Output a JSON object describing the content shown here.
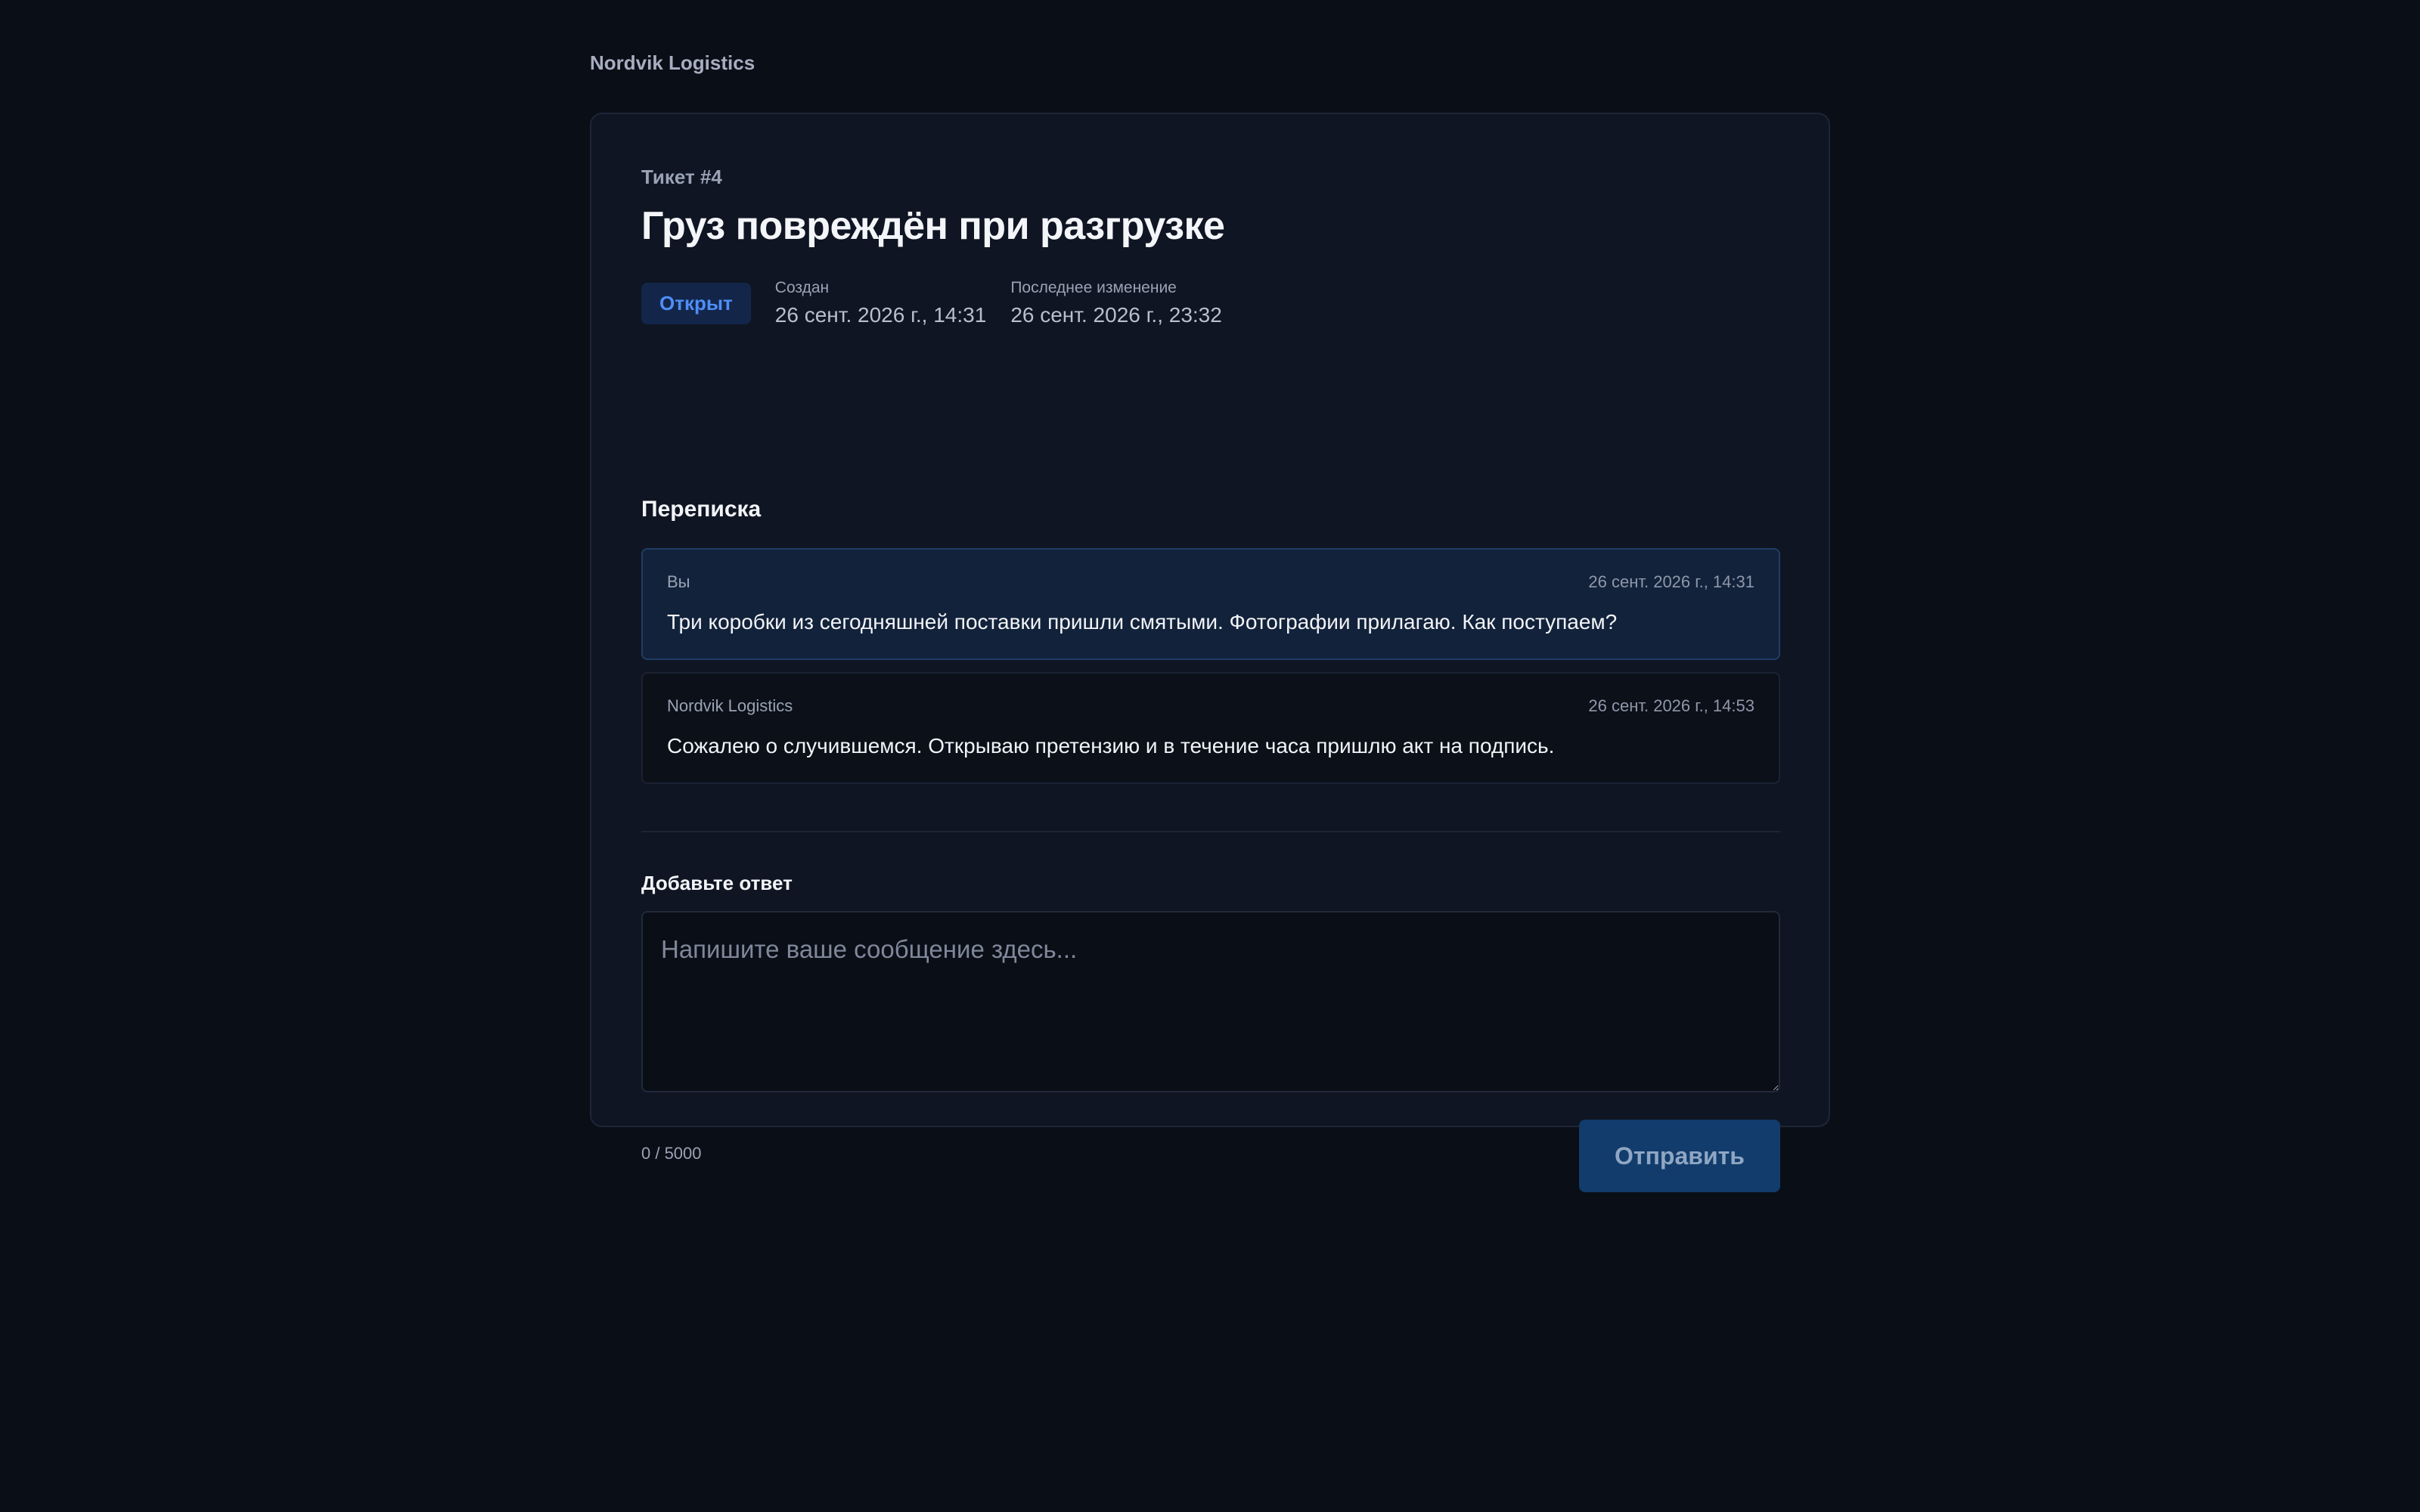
{
  "header": {
    "brand": "Nordvik Logistics"
  },
  "ticket": {
    "number_label": "Тикет #4",
    "title": "Груз повреждён при разгрузке",
    "status": "Открыт",
    "created_label": "Создан",
    "created_value": "26 сент. 2026 г., 14:31",
    "updated_label": "Последнее изменение",
    "updated_value": "26 сент. 2026 г., 23:32"
  },
  "conversation": {
    "title": "Переписка",
    "messages": [
      {
        "author": "Вы",
        "time": "26 сент. 2026 г., 14:31",
        "text": "Три коробки из сегодняшней поставки пришли смятыми. Фотографии прилагаю. Как поступаем?"
      },
      {
        "author": "Nordvik Logistics",
        "time": "26 сент. 2026 г., 14:53",
        "text": "Сожалею о случившемся. Открываю претензию и в течение часа пришлю акт на подпись."
      }
    ]
  },
  "reply": {
    "label": "Добавьте ответ",
    "placeholder": "Напишите ваше сообщение здесь...",
    "value": "",
    "counter": "0 / 5000",
    "send_label": "Отправить"
  },
  "colors": {
    "background": "#0a0e17",
    "card": "#0f1522",
    "status_badge_bg": "#13264a",
    "status_badge_text": "#4f8ef7",
    "own_message_bg": "#12223a",
    "send_button_bg": "#123c6b"
  }
}
